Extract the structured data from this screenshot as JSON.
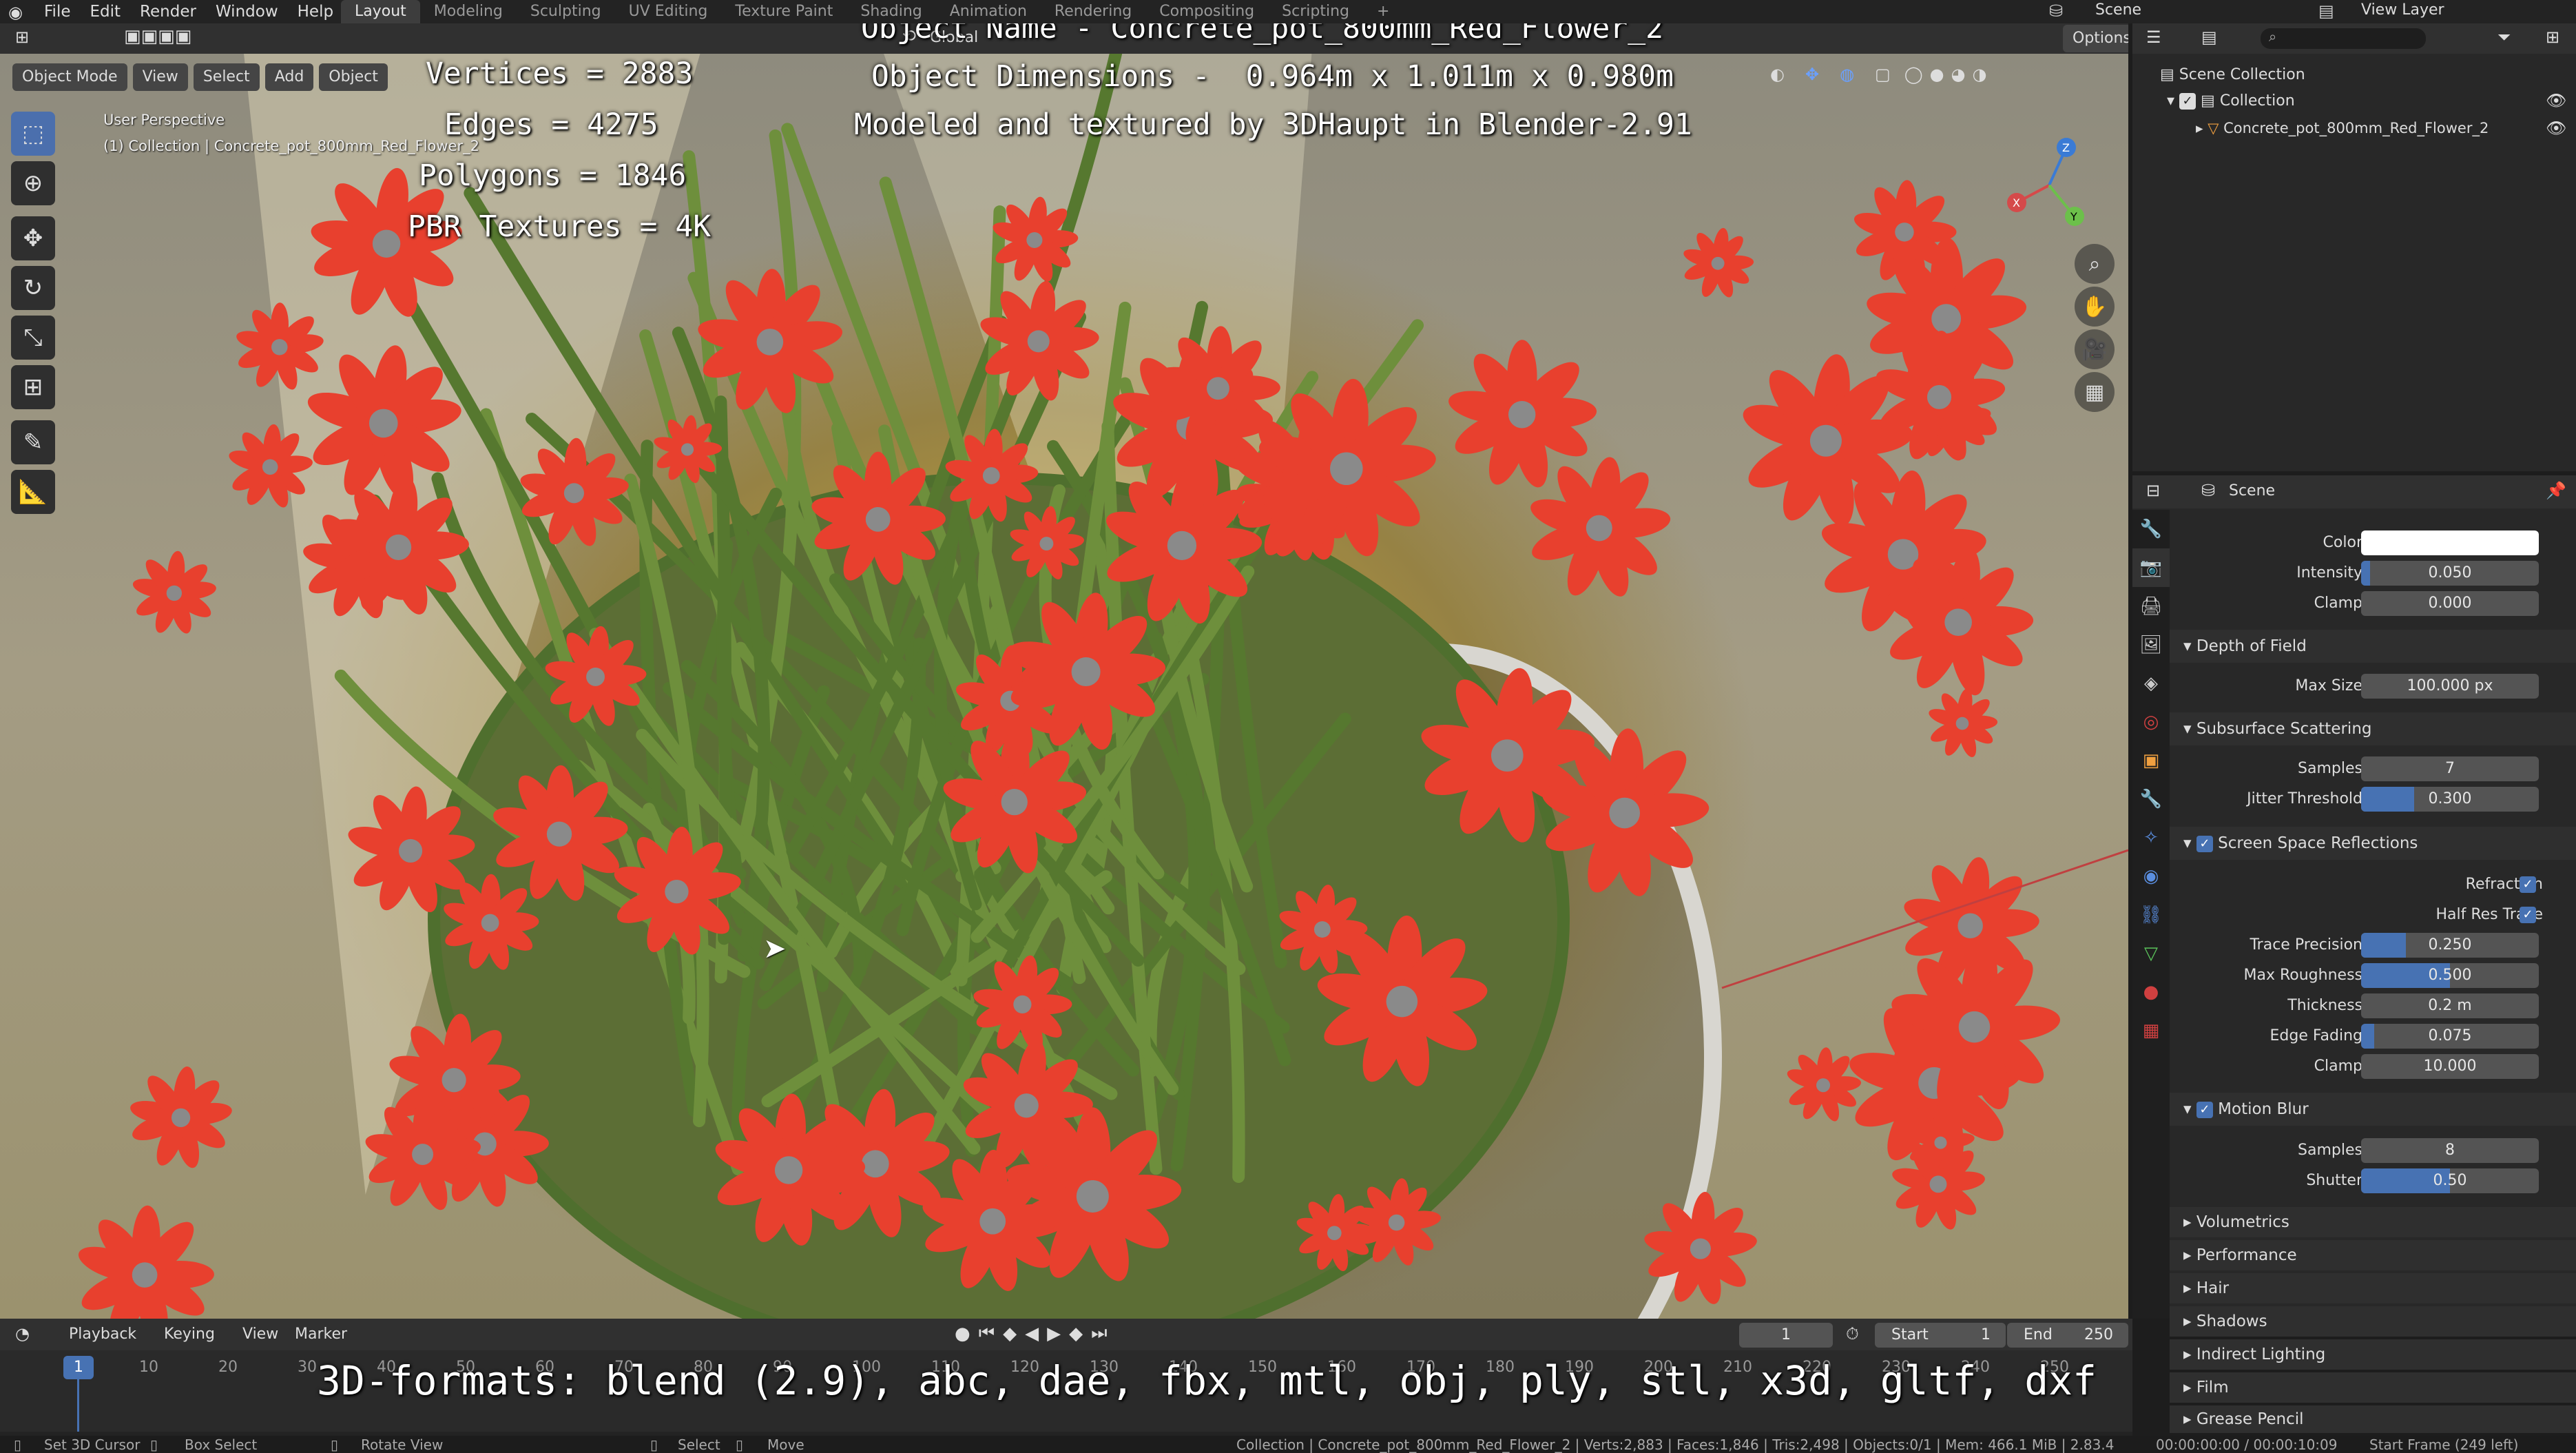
{
  "topbar": {
    "menus": [
      "File",
      "Edit",
      "Render",
      "Window",
      "Help"
    ],
    "workspaces": [
      "Layout",
      "Modeling",
      "Sculpting",
      "UV Editing",
      "Texture Paint",
      "Shading",
      "Animation",
      "Rendering",
      "Compositing",
      "Scripting"
    ],
    "scene_label": "Scene",
    "view_layer_label": "View Layer"
  },
  "viewport": {
    "mode": "Object Mode",
    "menu": [
      "View",
      "Select",
      "Add",
      "Object"
    ],
    "orientation": "Global",
    "options_label": "Options",
    "perspective": "User Perspective",
    "collection_path": "(1) Collection | Concrete_pot_800mm_Red_Flower_2",
    "overlay_stats": [
      "Vertices = 2883",
      "Edges = 4275",
      "Polygons = 1846",
      "PBR Textures = 4K"
    ],
    "overlay_info": [
      "Object Name - Concrete_pot_800mm_Red_Flower_2",
      "Object Dimensions -  0.964m x 1.011m x 0.980m",
      "Modeled and textured by 3DHaupt in Blender-2.91"
    ],
    "formats_banner": "3D-formats: blend (2.9), abc, dae, fbx, mtl, obj, ply, stl, x3d, gltf, dxf"
  },
  "outliner": {
    "root": "Scene Collection",
    "collection": "Collection",
    "object": "Concrete_pot_800mm_Red_Flower_2"
  },
  "properties": {
    "context": "Scene",
    "rows_top": [
      {
        "label": "Color",
        "value": "",
        "fill": 0
      },
      {
        "label": "Intensity",
        "value": "0.050",
        "fill": 0.05
      },
      {
        "label": "Clamp",
        "value": "0.000",
        "fill": 0
      }
    ],
    "dof": {
      "title": "Depth of Field",
      "rows": [
        {
          "label": "Max Size",
          "value": "100.000 px",
          "fill": 0
        }
      ]
    },
    "sss": {
      "title": "Subsurface Scattering",
      "rows": [
        {
          "label": "Samples",
          "value": "7",
          "fill": 0
        },
        {
          "label": "Jitter Threshold",
          "value": "0.300",
          "fill": 0.3
        }
      ]
    },
    "ssr": {
      "title": "Screen Space Reflections",
      "refraction": "Refraction",
      "half_res": "Half Res Trace",
      "rows": [
        {
          "label": "Trace Precision",
          "value": "0.250",
          "fill": 0.25
        },
        {
          "label": "Max Roughness",
          "value": "0.500",
          "fill": 0.5
        },
        {
          "label": "Thickness",
          "value": "0.2 m",
          "fill": 0
        },
        {
          "label": "Edge Fading",
          "value": "0.075",
          "fill": 0.075
        },
        {
          "label": "Clamp",
          "value": "10.000",
          "fill": 0
        }
      ]
    },
    "motion_blur": {
      "title": "Motion Blur",
      "rows": [
        {
          "label": "Samples",
          "value": "8",
          "fill": 0
        },
        {
          "label": "Shutter",
          "value": "0.50",
          "fill": 0.5
        }
      ]
    },
    "collapsed": [
      "Volumetrics",
      "Performance",
      "Hair",
      "Shadows",
      "Indirect Lighting",
      "Film",
      "Grease Pencil"
    ]
  },
  "timeline": {
    "menu": [
      "Playback",
      "Keying",
      "View",
      "Marker"
    ],
    "current_frame": "1",
    "start_label": "Start",
    "start": "1",
    "end_label": "End",
    "end": "250",
    "ticks": [
      "10",
      "20",
      "30",
      "40",
      "50",
      "60",
      "70",
      "80",
      "90",
      "100",
      "110",
      "120",
      "130",
      "140",
      "150",
      "160",
      "170",
      "180",
      "190",
      "200",
      "210",
      "220",
      "230",
      "240",
      "250"
    ]
  },
  "statusbar": {
    "left": [
      "Set 3D Cursor",
      "Box Select",
      "Rotate View",
      "Select",
      "Move"
    ],
    "stats": "Collection | Concrete_pot_800mm_Red_Flower_2 | Verts:2,883 | Faces:1,846 | Tris:2,498 | Objects:0/1 | Mem: 466.1 MiB | 2.83.4",
    "time": "00:00:00:00 / 00:00:10:09",
    "start_frame": "Start Frame (249 left)"
  },
  "colors": {
    "accent": "#4772b3",
    "flower": "#e8402e",
    "header": "#303030"
  }
}
